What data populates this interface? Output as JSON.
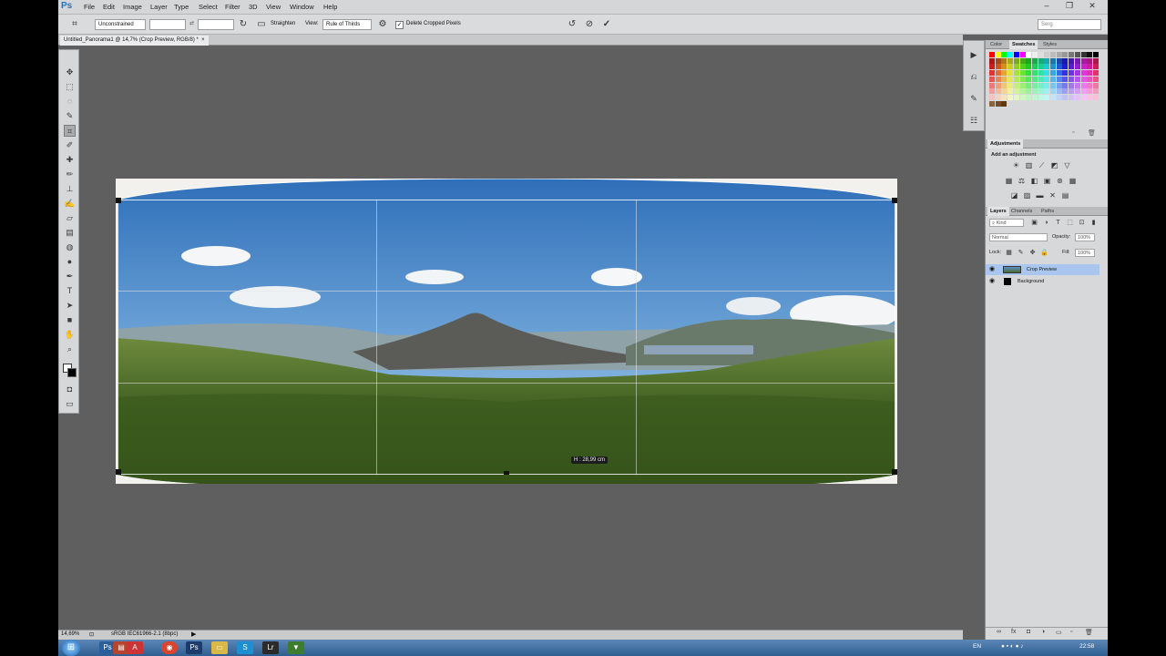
{
  "app": {
    "logo": "Ps"
  },
  "menu": [
    "File",
    "Edit",
    "Image",
    "Layer",
    "Type",
    "Select",
    "Filter",
    "3D",
    "View",
    "Window",
    "Help"
  ],
  "window_controls": [
    "minimize-icon",
    "restore-icon",
    "close-icon"
  ],
  "options": {
    "ratio_select": "Unconstrained",
    "width_value": "",
    "height_value": "",
    "straighten_label": "Straighten",
    "view_label": "View:",
    "view_select": "Rule of Thirds",
    "delete_cropped_label": "Delete Cropped Pixels",
    "delete_cropped_checked": true,
    "workspace": "Serg"
  },
  "document": {
    "tab_title": "Untitled_Panorama1 @ 14,7% (Crop Preview, RGB/8) *",
    "dimension_tip": "H : 28,99 cm"
  },
  "status": {
    "zoom": "14,69%",
    "profile": "sRGB IEC61966-2.1 (8bpc)"
  },
  "panels": {
    "color_tabs": [
      "Color",
      "Swatches",
      "Styles"
    ],
    "color_active": "Swatches",
    "adjustments_tab": "Adjustments",
    "adjustments_hint": "Add an adjustment",
    "layers_tabs": [
      "Layers",
      "Channels",
      "Paths"
    ],
    "layers_active": "Layers",
    "kind_filter": "Kind",
    "blend_mode": "Normal",
    "opacity_label": "Opacity:",
    "opacity_value": "100%",
    "lock_label": "Lock:",
    "fill_label": "Fill:",
    "fill_value": "100%",
    "layers": [
      {
        "name": "Crop Preview",
        "selected": true
      },
      {
        "name": "Background",
        "selected": false
      }
    ]
  },
  "taskbar": {
    "language": "EN",
    "time": "22:58"
  }
}
